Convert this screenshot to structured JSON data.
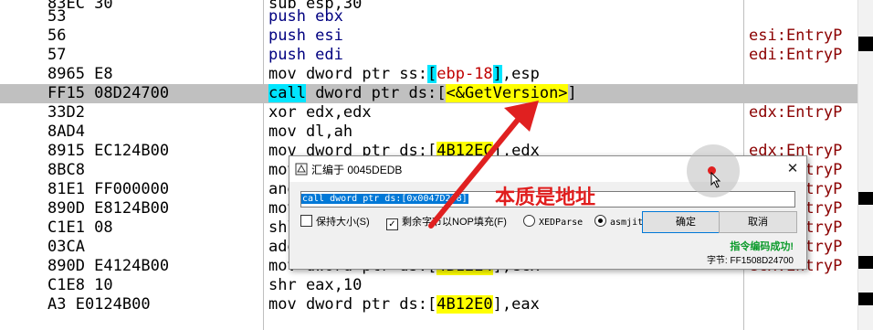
{
  "disassembly": {
    "rows": [
      {
        "bytes": "83EC 30",
        "instr": [
          {
            "t": "sub esp,30",
            "c": ""
          }
        ],
        "comment": ""
      },
      {
        "bytes": "53",
        "instr": [
          {
            "t": "push ebx",
            "c": "kw"
          }
        ],
        "comment": ""
      },
      {
        "bytes": "56",
        "instr": [
          {
            "t": "push esi",
            "c": "kw"
          }
        ],
        "comment": "esi:EntryP"
      },
      {
        "bytes": "57",
        "instr": [
          {
            "t": "push edi",
            "c": "kw"
          }
        ],
        "comment": "edi:EntryP"
      },
      {
        "bytes": "8965 E8",
        "instr": [
          {
            "t": "mov dword ptr ss:",
            "c": ""
          },
          {
            "t": "[",
            "c": "brk"
          },
          {
            "t": "ebp-18",
            "c": "hl-red"
          },
          {
            "t": "]",
            "c": "brk"
          },
          {
            "t": ",esp",
            "c": ""
          }
        ],
        "comment": ""
      },
      {
        "bytes": "FF15 08D24700",
        "instr": [
          {
            "t": "call",
            "c": "kwcall"
          },
          {
            "t": " dword ptr ds:[",
            "c": ""
          },
          {
            "t": "<&GetVersion>",
            "c": "yel"
          },
          {
            "t": "]",
            "c": ""
          }
        ],
        "comment": "",
        "selected": true
      },
      {
        "bytes": "33D2",
        "instr": [
          {
            "t": "xor edx,edx",
            "c": ""
          }
        ],
        "comment": "edx:EntryP"
      },
      {
        "bytes": "8AD4",
        "instr": [
          {
            "t": "mov dl,ah",
            "c": ""
          }
        ],
        "comment": ""
      },
      {
        "bytes": "8915 EC124B00",
        "instr": [
          {
            "t": "mov dword ptr ds:[",
            "c": ""
          },
          {
            "t": "4B12EC",
            "c": "yel"
          },
          {
            "t": "],edx",
            "c": ""
          }
        ],
        "comment": "edx:EntryP"
      },
      {
        "bytes": "8BC8",
        "instr": [
          {
            "t": "mov ecx,eax",
            "c": ""
          }
        ],
        "comment": "ecx:EntryP"
      },
      {
        "bytes": "81E1 FF000000",
        "instr": [
          {
            "t": "and ecx,FF",
            "c": ""
          }
        ],
        "comment": "ecx:EntryP"
      },
      {
        "bytes": "890D E8124B00",
        "instr": [
          {
            "t": "mov dword ptr ds:[4B12E8],ecx",
            "c": ""
          }
        ],
        "comment": "ecx:EntryP"
      },
      {
        "bytes": "C1E1 08",
        "instr": [
          {
            "t": "shl ecx,8",
            "c": ""
          }
        ],
        "comment": "ecx:EntryP"
      },
      {
        "bytes": "03CA",
        "instr": [
          {
            "t": "add ecx,edx",
            "c": ""
          }
        ],
        "comment": "ecx:EntryP"
      },
      {
        "bytes": "890D E4124B00",
        "instr": [
          {
            "t": "mov dword ptr ds:[",
            "c": ""
          },
          {
            "t": "4B12E4",
            "c": "yel"
          },
          {
            "t": "],ecx",
            "c": ""
          }
        ],
        "comment": "ecx:EntryP"
      },
      {
        "bytes": "C1E8 10",
        "instr": [
          {
            "t": "shr eax,10",
            "c": ""
          }
        ],
        "comment": ""
      },
      {
        "bytes": "A3 E0124B00",
        "instr": [
          {
            "t": "mov dword ptr ds:[",
            "c": ""
          },
          {
            "t": "4B12E0",
            "c": "yel"
          },
          {
            "t": "],eax",
            "c": ""
          }
        ],
        "comment": ""
      }
    ]
  },
  "dialog": {
    "title": "汇编于 0045DEDB",
    "close_glyph": "✕",
    "input_value": "call dword ptr ds:[0x0047D208]",
    "options": {
      "keep_size": "保持大小(S)",
      "fill_nop": "剩余字节以NOP填充(F)",
      "xedparse": "XEDParse",
      "asmjit": "asmjit"
    },
    "buttons": {
      "ok": "确定",
      "cancel": "取消"
    },
    "status": "指令编码成功!",
    "bytes_label": "字节: FF1508D24700"
  },
  "annotation": {
    "text": "本质是地址",
    "arrow_color": "#e02020"
  }
}
